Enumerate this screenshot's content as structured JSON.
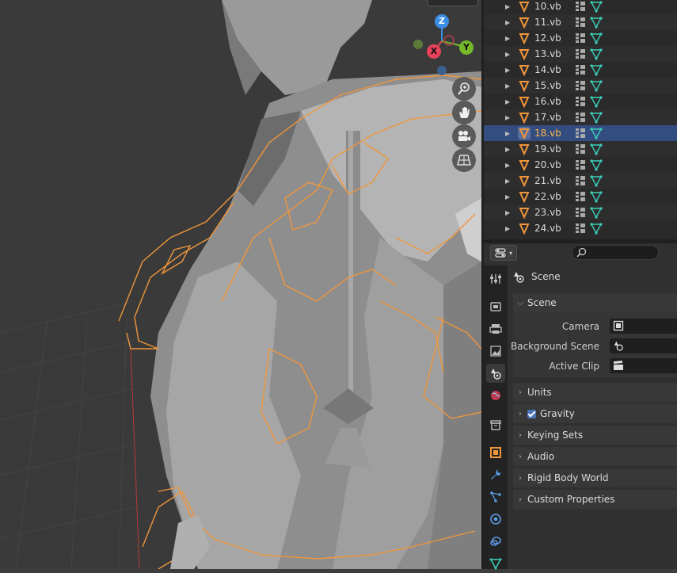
{
  "outliner": {
    "rows": [
      {
        "name": "10.vb",
        "selected": false
      },
      {
        "name": "11.vb",
        "selected": false
      },
      {
        "name": "12.vb",
        "selected": false
      },
      {
        "name": "13.vb",
        "selected": false
      },
      {
        "name": "14.vb",
        "selected": false
      },
      {
        "name": "15.vb",
        "selected": false
      },
      {
        "name": "16.vb",
        "selected": false
      },
      {
        "name": "17.vb",
        "selected": false
      },
      {
        "name": "18.vb",
        "selected": true
      },
      {
        "name": "19.vb",
        "selected": false
      },
      {
        "name": "20.vb",
        "selected": false
      },
      {
        "name": "21.vb",
        "selected": false
      },
      {
        "name": "22.vb",
        "selected": false
      },
      {
        "name": "23.vb",
        "selected": false
      },
      {
        "name": "24.vb",
        "selected": false
      }
    ]
  },
  "gizmo": {
    "z": "Z",
    "x": "X",
    "y": "Y"
  },
  "properties": {
    "context": "Scene",
    "scene_panel": {
      "title": "Scene",
      "camera_label": "Camera",
      "background_scene_label": "Background Scene",
      "active_clip_label": "Active Clip"
    },
    "panels": [
      {
        "title": "Units",
        "checkbox": false
      },
      {
        "title": "Gravity",
        "checkbox": true
      },
      {
        "title": "Keying Sets",
        "checkbox": false
      },
      {
        "title": "Audio",
        "checkbox": false
      },
      {
        "title": "Rigid Body World",
        "checkbox": false
      },
      {
        "title": "Custom Properties",
        "checkbox": false
      }
    ]
  },
  "colors": {
    "selection_outline": "#f0963c",
    "selected_row": "#334d80",
    "accent_orange": "#ffb447",
    "mesh_teal": "#3ccfb8",
    "axis_x": "#e8425a",
    "axis_y": "#75b82a",
    "axis_z": "#3b8ee4"
  }
}
